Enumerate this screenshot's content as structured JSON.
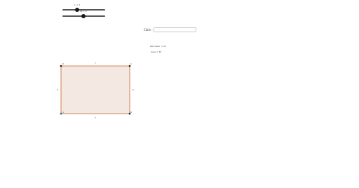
{
  "sliders": [
    {
      "caption": "L = 7",
      "value_fraction": 0.35
    },
    {
      "caption": "W = 5",
      "value_fraction": 0.49
    }
  ],
  "command_input": {
    "label": "Cible :",
    "value": "",
    "placeholder": ""
  },
  "readouts": {
    "perimeter": "Perimeter = 24",
    "area": "Area = 35"
  },
  "figure": {
    "fill_color": "#f4e8e2",
    "stroke_color": "#c8602c",
    "point_color": "#1a1a1a",
    "point_a_color": "#3b4cc0",
    "vertices": [
      "A",
      "B",
      "C",
      "D"
    ],
    "side_labels": {
      "top": "7",
      "bottom": "7",
      "left": "5",
      "right": "5"
    }
  }
}
